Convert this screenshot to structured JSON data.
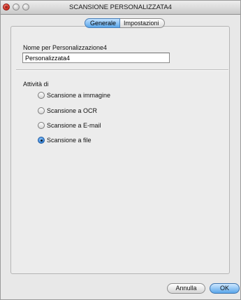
{
  "window": {
    "title": "SCANSIONE PERSONALIZZATA4"
  },
  "tabs": [
    {
      "label": "Generale",
      "active": true
    },
    {
      "label": "Impostazioni",
      "active": false
    }
  ],
  "name_field": {
    "label": "Nome per Personalizzazione4",
    "value": "Personalizzata4"
  },
  "activity": {
    "label": "Attività di",
    "options": [
      {
        "label": "Scansione a immagine",
        "selected": false
      },
      {
        "label": "Scansione a OCR",
        "selected": false
      },
      {
        "label": "Scansione a E-mail",
        "selected": false
      },
      {
        "label": "Scansione a file",
        "selected": true
      }
    ]
  },
  "buttons": {
    "cancel": "Annulla",
    "ok": "OK"
  },
  "colors": {
    "accent": "#5aa6ea",
    "close": "#d0281c"
  }
}
